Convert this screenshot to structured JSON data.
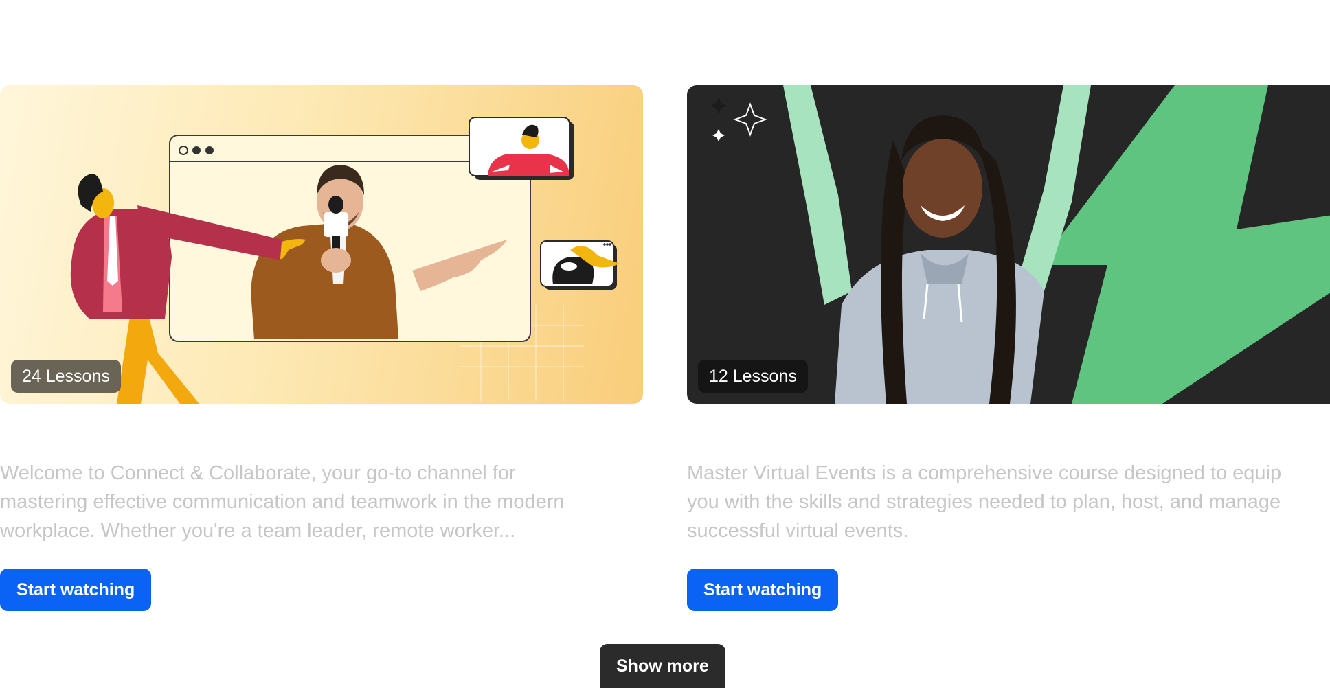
{
  "courses": [
    {
      "lessons_badge": "24 Lessons",
      "description_lines": [
        "Welcome to Connect & Collaborate, your go-to channel for",
        "mastering effective communication and teamwork in the modern",
        "workplace. Whether you're a team leader, remote worker..."
      ],
      "cta_label": "Start watching",
      "thumbnail": "Illustration of a man in a brown cardigan holding a microphone inside a browser window, with cartoon figures around him"
    },
    {
      "lessons_badge": "12 Lessons",
      "description_lines": [
        "Master Virtual Events is a comprehensive course designed to equip",
        "you with the skills and strategies needed to plan, host, and manage",
        "successful virtual events."
      ],
      "cta_label": "Start watching",
      "thumbnail": "Smiling woman with braids raising arms in front of a dark background with a green lightning bolt"
    }
  ],
  "show_more_label": "Show more",
  "colors": {
    "primary_button": "#0b63f6",
    "show_more_button": "#2b2b2b",
    "description_text": "#c6c6c6",
    "bolt_green": "#5ec47f"
  }
}
